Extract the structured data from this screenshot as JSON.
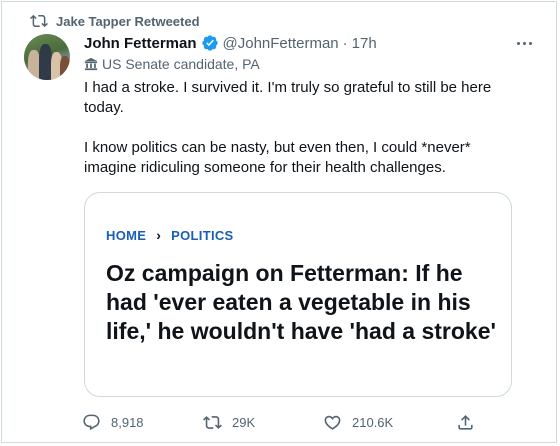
{
  "retweet": {
    "label": "Jake Tapper Retweeted"
  },
  "author": {
    "name": "John Fetterman",
    "handle": "@JohnFetterman",
    "separator": "·",
    "time": "17h",
    "label": "US Senate candidate, PA"
  },
  "tweet": {
    "paragraph1": "I had a stroke. I survived it. I'm truly so grateful to still be here today.",
    "paragraph2": "I know politics can be nasty, but even then, I could *never* imagine ridiculing someone for their health challenges."
  },
  "card": {
    "breadcrumb_home": "HOME",
    "breadcrumb_sep": "›",
    "breadcrumb_section": "POLITICS",
    "headline": "Oz campaign on Fetterman: If he had 'ever eaten a vegetable in his life,' he wouldn't have 'had a stroke'"
  },
  "actions": {
    "replies": "8,918",
    "retweets": "29K",
    "likes": "210.6K"
  },
  "icons": {
    "retweet": "retweet-icon",
    "verified": "verified-badge-icon",
    "label": "government-building-icon",
    "more": "more-icon",
    "reply": "reply-icon",
    "like": "heart-icon",
    "share": "share-icon"
  },
  "colors": {
    "secondary_text": "#536471",
    "breadcrumb": "#1a5fb4",
    "verified": "#1d9bf0"
  }
}
